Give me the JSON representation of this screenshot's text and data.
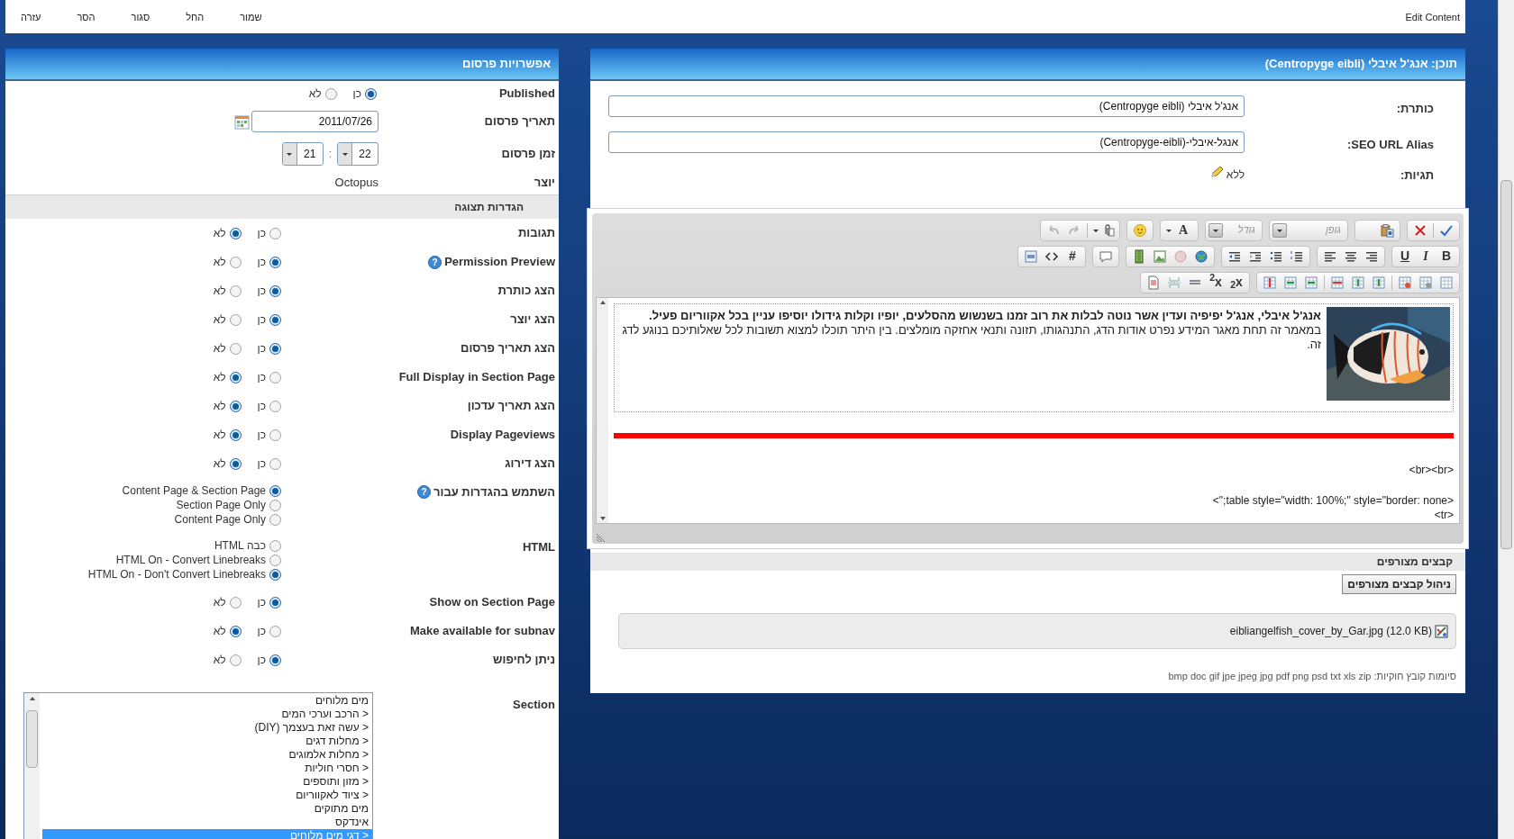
{
  "top_bar": {
    "menu": [
      "שמור",
      "החל",
      "סגור",
      "הסר",
      "עזרה"
    ],
    "title": "Edit Content"
  },
  "publish_panel": {
    "title": "אפשרויות פרסום",
    "published": {
      "label": "Published",
      "options": [
        {
          "label": "כן",
          "selected": true
        },
        {
          "label": "לא",
          "selected": false
        }
      ]
    },
    "date": {
      "label": "תאריך פרסום",
      "value": "2011/07/26"
    },
    "time": {
      "label": "זמן פרסום",
      "hour": "22",
      "separator": ":",
      "minute": "21"
    },
    "author": {
      "label": "יוצר",
      "value": "Octopus"
    },
    "display_settings": {
      "title": "הגדרות תצוגה",
      "settings": [
        {
          "label": "תגובות",
          "kind": "pair",
          "options": [
            {
              "label": "כן",
              "selected": false
            },
            {
              "label": "לא",
              "selected": true
            }
          ]
        },
        {
          "label": "Permission Preview",
          "help": "?",
          "kind": "pair",
          "options": [
            {
              "label": "כן",
              "selected": true
            },
            {
              "label": "לא",
              "selected": false
            }
          ]
        },
        {
          "label": "הצג כותרת",
          "kind": "pair",
          "options": [
            {
              "label": "כן",
              "selected": true
            },
            {
              "label": "לא",
              "selected": false
            }
          ]
        },
        {
          "label": "הצג יוצר",
          "kind": "pair",
          "options": [
            {
              "label": "כן",
              "selected": true
            },
            {
              "label": "לא",
              "selected": false
            }
          ]
        },
        {
          "label": "הצג תאריך פרסום",
          "kind": "pair",
          "options": [
            {
              "label": "כן",
              "selected": true
            },
            {
              "label": "לא",
              "selected": false
            }
          ]
        },
        {
          "label": "Full Display in Section Page",
          "kind": "pair",
          "options": [
            {
              "label": "כן",
              "selected": false
            },
            {
              "label": "לא",
              "selected": true
            }
          ]
        },
        {
          "label": "הצג תאריך עדכון",
          "kind": "pair",
          "options": [
            {
              "label": "כן",
              "selected": false
            },
            {
              "label": "לא",
              "selected": true
            }
          ]
        },
        {
          "label": "Display Pageviews",
          "kind": "pair",
          "options": [
            {
              "label": "כן",
              "selected": false
            },
            {
              "label": "לא",
              "selected": true
            }
          ]
        },
        {
          "label": "הצג דירוג",
          "kind": "pair",
          "options": [
            {
              "label": "כן",
              "selected": false
            },
            {
              "label": "לא",
              "selected": true
            }
          ]
        },
        {
          "label": "השתמש בהגדרות עבור",
          "help": "?",
          "kind": "list",
          "options": [
            {
              "label": "Content Page & Section Page",
              "selected": true
            },
            {
              "label": "Section Page Only",
              "selected": false
            },
            {
              "label": "Content Page Only",
              "selected": false
            }
          ]
        },
        {
          "label": "HTML",
          "kind": "list",
          "options": [
            {
              "label": "כבה HTML",
              "selected": false
            },
            {
              "label": "HTML On - Convert Linebreaks",
              "selected": false
            },
            {
              "label": "HTML On - Don't Convert Linebreaks",
              "selected": true
            }
          ]
        },
        {
          "label": "Show on Section Page",
          "kind": "pair",
          "options": [
            {
              "label": "כן",
              "selected": true
            },
            {
              "label": "לא",
              "selected": false
            }
          ]
        },
        {
          "label": "Make available for subnav",
          "kind": "pair",
          "options": [
            {
              "label": "כן",
              "selected": false
            },
            {
              "label": "לא",
              "selected": true
            }
          ]
        },
        {
          "label": "ניתן לחיפוש",
          "kind": "pair",
          "options": [
            {
              "label": "כן",
              "selected": true
            },
            {
              "label": "לא",
              "selected": false
            }
          ]
        }
      ]
    },
    "section": {
      "label": "Section",
      "items": [
        {
          "label": "מים מלוחים",
          "selected": false
        },
        {
          "label": "< הרכב וערכי המים",
          "selected": false
        },
        {
          "label": "< עשה זאת בעצמך (DIY)",
          "selected": false
        },
        {
          "label": "< מחלות דגים",
          "selected": false
        },
        {
          "label": "< מחלות אלמוגים",
          "selected": false
        },
        {
          "label": "< חסרי חוליות",
          "selected": false
        },
        {
          "label": "< מזון ותוספים",
          "selected": false
        },
        {
          "label": "< ציוד לאקווריום",
          "selected": false
        },
        {
          "label": "מים מתוקים",
          "selected": false
        },
        {
          "label": "אינדקס",
          "selected": false
        },
        {
          "label": "< דגי מים מלוחים",
          "selected": true
        }
      ]
    }
  },
  "content_panel": {
    "title": "תוכן: אנג'ל איבלי (Centropyge eibli)",
    "fields": [
      {
        "label": "כותרת:",
        "value": "אנג'ל איבלי (Centropyge eibli)"
      },
      {
        "label": "SEO URL Alias:",
        "value": "אנגל-איבלי-(Centropyge-eibli)"
      }
    ],
    "tags": {
      "label": "תגיות:",
      "value": "ללא"
    },
    "editor": {
      "toolbar": {
        "font_placeholder": "גופן",
        "size_placeholder": "גודל",
        "font_color": "A",
        "bold": "B",
        "italic": "I",
        "underline": "U",
        "anchor": "#",
        "superscript": "x$^{2}$",
        "subscript": "x$_{2}$"
      },
      "heading": "אנג'ל איבלי, אנג'ל יפיפיה ועדין אשר נוטה לבלות את רוב זמנו בשנשוש מהסלעים, יופיו וקלות גידולו יוסיפו עניין בכל אקווריום פעיל.",
      "text": "במאמר זה תחת מאגר המידע נפרט אודות הדג, התנהגותו, תזונה ותנאי אחזקה מומלצים. בין היתר תוכלו למצוא תשובות לכל שאלותיכם בנוגע לדג זה.",
      "source_lines": [
        "<br><br>",
        "<table style=\"width: 100%;\" style=\"border: none;\">",
        "<tr>"
      ]
    },
    "attachments": {
      "title": "קבצים מצורפים",
      "manage_button": "ניהול קבצים מצורפים",
      "files": [
        "eibliangelfish_cover_by_Gar.jpg (12.0 KB)"
      ],
      "allowed": "סיומות קובץ חוקיות: bmp doc gif jpe jpeg jpg pdf png psd txt xls zip"
    }
  }
}
